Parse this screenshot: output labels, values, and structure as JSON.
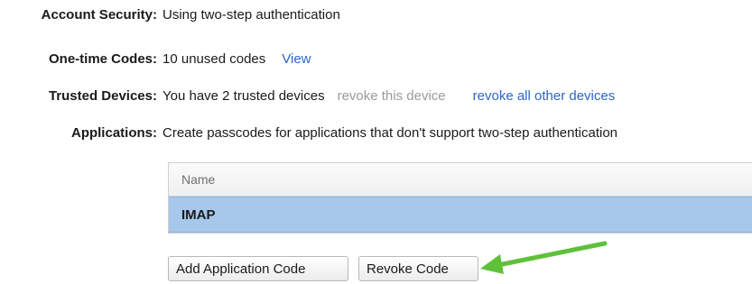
{
  "account_security": {
    "label": "Account Security:",
    "value": "Using two-step authentication"
  },
  "one_time_codes": {
    "label": "One-time Codes:",
    "value": "10 unused codes",
    "view_link": "View"
  },
  "trusted_devices": {
    "label": "Trusted Devices:",
    "value": "You have 2 trusted devices",
    "revoke_this_link": "revoke this device",
    "revoke_all_link": "revoke all other devices"
  },
  "applications": {
    "label": "Applications:",
    "description": "Create passcodes for applications that don't support two-step authentication",
    "table": {
      "header": "Name",
      "rows": [
        "IMAP"
      ]
    },
    "buttons": {
      "add": "Add Application Code",
      "revoke": "Revoke Code"
    }
  },
  "colors": {
    "link": "#2a66c7",
    "muted_link": "#9a9a9a",
    "selected_row": "#a7c8ea",
    "arrow": "#5fc13a"
  }
}
